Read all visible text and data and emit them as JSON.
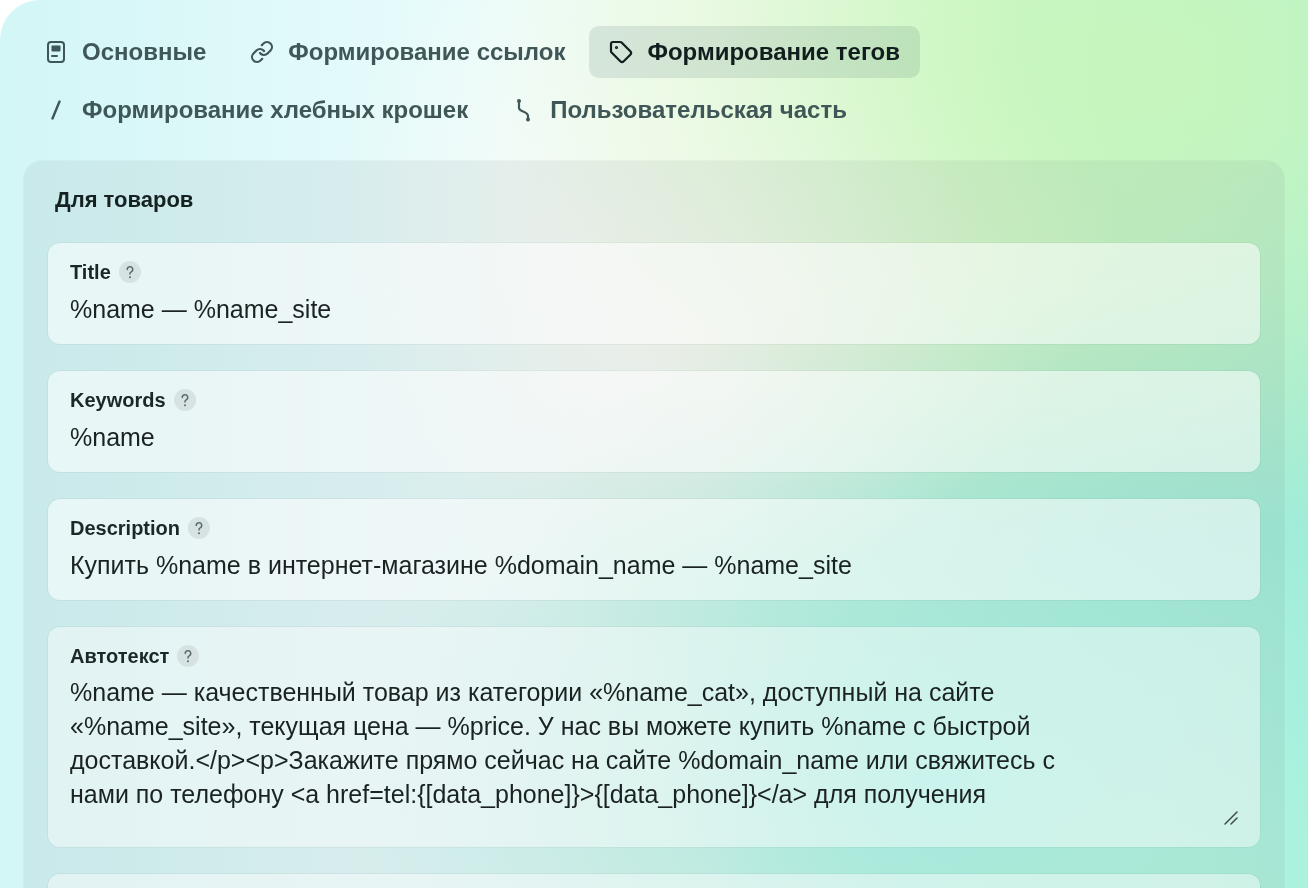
{
  "tabs": [
    {
      "label": "Основные",
      "selected": false
    },
    {
      "label": "Формирование ссылок",
      "selected": false
    },
    {
      "label": "Формирование тегов",
      "selected": true
    },
    {
      "label": "Формирование хлебных крошек",
      "selected": false
    },
    {
      "label": "Пользовательская часть",
      "selected": false
    }
  ],
  "panel": {
    "title": "Для товаров",
    "fields": [
      {
        "kind": "input",
        "label": "Title",
        "value": "%name — %name_site"
      },
      {
        "kind": "input",
        "label": "Keywords",
        "value": "%name"
      },
      {
        "kind": "input",
        "label": "Description",
        "value": "Купить %name в интернет-магазине %domain_name — %name_site"
      },
      {
        "kind": "textarea",
        "label": "Автотекст",
        "value_lines": [
          "%name — качественный товар из категории «%name_cat», доступный на сайте",
          "«%name_site», текущая цена — %price. У нас вы можете купить %name с быстрой",
          "доставкой.</p><p>Закажите прямо сейчас на сайте %domain_name или свяжитесь с",
          "нами по телефону <a href=tel:{[data_phone]}>{[data_phone]}</a> для получения"
        ]
      }
    ]
  }
}
